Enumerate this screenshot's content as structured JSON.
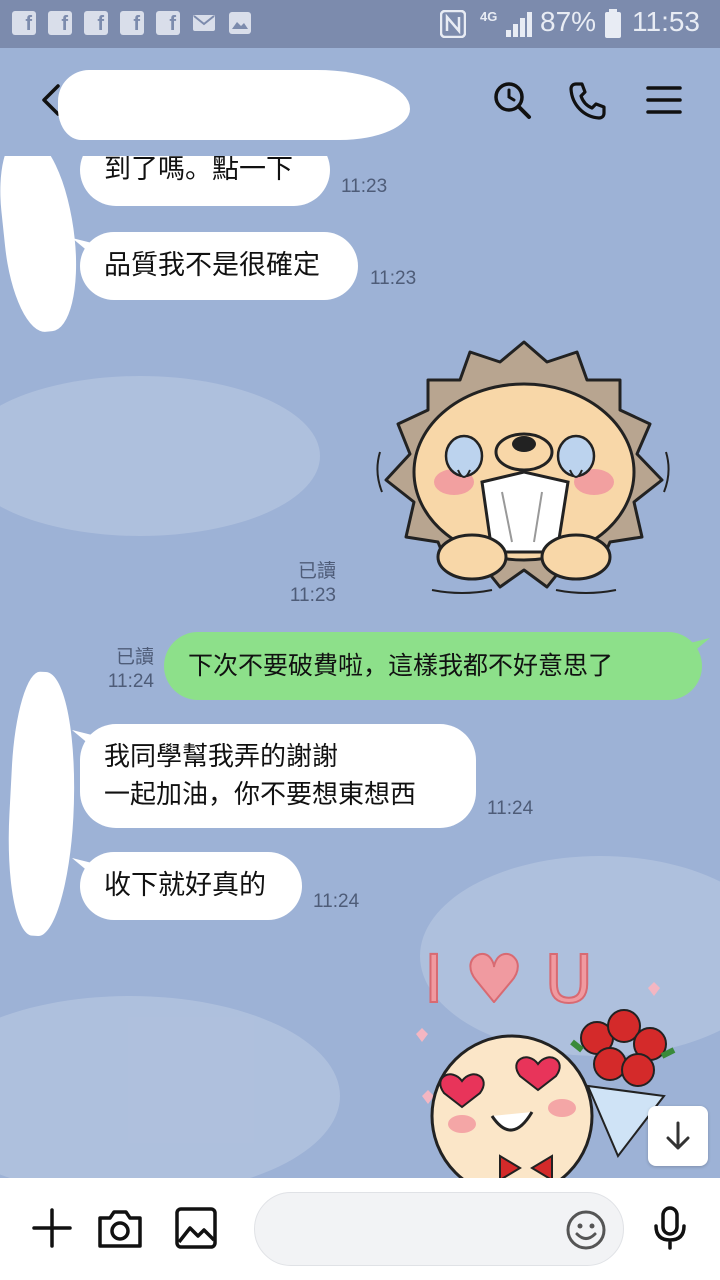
{
  "status_bar": {
    "battery": "87%",
    "time": "11:53",
    "network": "4G",
    "notification_icons": [
      "facebook-icon",
      "facebook-icon",
      "facebook-icon",
      "facebook-icon",
      "facebook-icon",
      "mail-icon",
      "image-icon"
    ]
  },
  "header": {
    "icons": [
      "back-icon",
      "search-icon",
      "call-icon",
      "menu-icon"
    ]
  },
  "messages": [
    {
      "dir": "in",
      "text": "到了嗎。點一下",
      "time": "11:23"
    },
    {
      "dir": "in",
      "text": "品質我不是很確定",
      "time": "11:23"
    },
    {
      "dir": "out",
      "type": "sticker",
      "sticker": "crying-lion-sticker",
      "read": "已讀",
      "time": "11:23"
    },
    {
      "dir": "out",
      "text": "下次不要破費啦，這樣我都不好意思了",
      "read": "已讀",
      "time": "11:24"
    },
    {
      "dir": "in",
      "text": "我同學幫我弄的謝謝\n一起加油，你不要想東想西",
      "time": "11:24"
    },
    {
      "dir": "in",
      "text": "收下就好真的",
      "time": "11:24"
    },
    {
      "dir": "in",
      "type": "sticker",
      "sticker": "i-love-u-sticker",
      "sticker_text": "I ♥ U"
    }
  ],
  "input_bar": {
    "placeholder": "",
    "icons": [
      "plus-icon",
      "camera-icon",
      "gallery-icon",
      "emoji-icon",
      "mic-icon"
    ]
  },
  "colors": {
    "chat_background": "#9db2d6",
    "incoming_bubble": "#ffffff",
    "outgoing_bubble": "#8de08a",
    "status_bar": "#7c8bad"
  }
}
